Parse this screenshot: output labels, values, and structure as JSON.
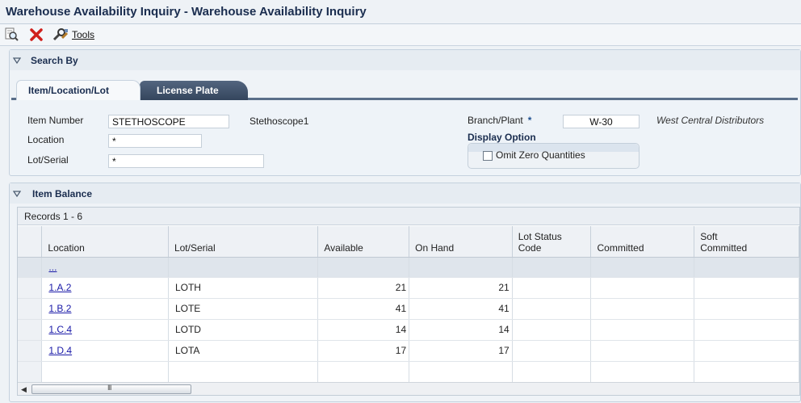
{
  "window": {
    "title": "Warehouse Availability Inquiry - Warehouse Availability Inquiry"
  },
  "toolbar": {
    "tools_label": "Tools",
    "find_icon": "find-icon",
    "close_icon": "close-x-icon",
    "tools_icon": "tools-icon"
  },
  "search_by": {
    "header": "Search By",
    "tabs": [
      {
        "label": "Item/Location/Lot",
        "active": true
      },
      {
        "label": "License Plate",
        "active": false
      }
    ],
    "item_number_label": "Item Number",
    "item_number_value": "STETHOSCOPE",
    "item_description": "Stethoscope1",
    "location_label": "Location",
    "location_value": "*",
    "lot_serial_label": "Lot/Serial",
    "lot_serial_value": "*",
    "branch_plant_label": "Branch/Plant",
    "branch_plant_required": "*",
    "branch_plant_value": "W-30",
    "branch_plant_description": "West Central Distributors",
    "display_option_label": "Display Option",
    "omit_zero_label": "Omit Zero Quantities",
    "omit_zero_checked": false
  },
  "item_balance": {
    "header": "Item Balance",
    "records_text": "Records 1 - 6",
    "columns": [
      "Location",
      "Lot/Serial",
      "Available",
      "On Hand",
      "Lot Status\nCode",
      "Committed",
      "Soft\nCommitted"
    ],
    "qbe_link": "...",
    "rows": [
      {
        "location": "1.A.2",
        "lot": "LOTH",
        "available": "21",
        "on_hand": "21"
      },
      {
        "location": "1.B.2",
        "lot": "LOTE",
        "available": "41",
        "on_hand": "41"
      },
      {
        "location": "1.C.4",
        "lot": "LOTD",
        "available": "14",
        "on_hand": "14"
      },
      {
        "location": "1.D.4",
        "lot": "LOTA",
        "available": "17",
        "on_hand": "17"
      }
    ],
    "scroll_thumb_grip": "III"
  },
  "colors": {
    "title_text": "#1a2d4f",
    "link": "#1a1aa8",
    "tab_dark": "#3f516b"
  }
}
